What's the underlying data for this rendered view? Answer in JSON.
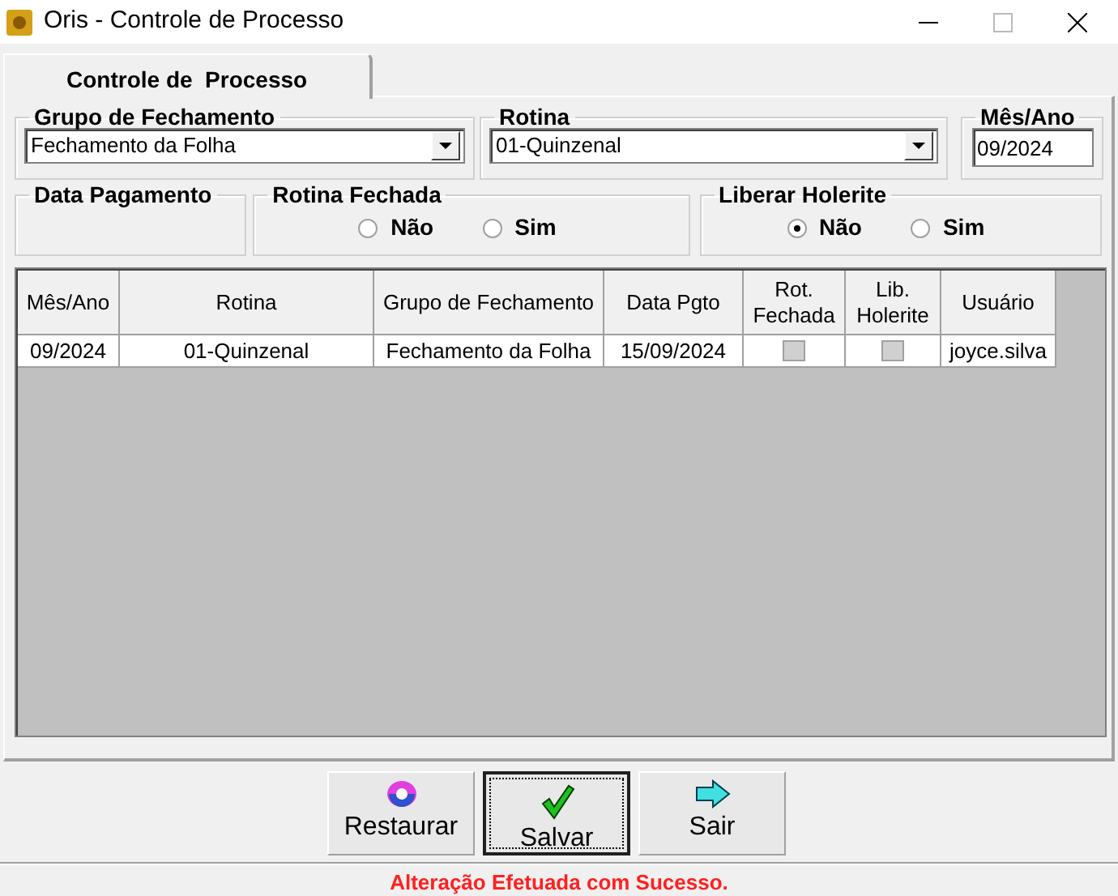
{
  "window": {
    "title": "Oris - Controle de Processo"
  },
  "tabs": [
    {
      "label": "Controle de  Processo",
      "selected": true
    }
  ],
  "grupo_fechamento": {
    "label": "Grupo de Fechamento",
    "value": "Fechamento da Folha"
  },
  "rotina": {
    "label": "Rotina",
    "value": "01-Quinzenal"
  },
  "mes_ano": {
    "label": "Mês/Ano",
    "value": "09/2024"
  },
  "data_pagamento": {
    "label": "Data Pagamento"
  },
  "rotina_fechada": {
    "label": "Rotina Fechada",
    "options": [
      {
        "label": "Não",
        "selected": false
      },
      {
        "label": "Sim",
        "selected": false
      }
    ]
  },
  "liberar_holerite": {
    "label": "Liberar Holerite",
    "options": [
      {
        "label": "Não",
        "selected": true
      },
      {
        "label": "Sim",
        "selected": false
      }
    ]
  },
  "table": {
    "columns": [
      "Mês/Ano",
      "Rotina",
      "Grupo de Fechamento",
      "Data Pgto",
      "Rot.\nFechada",
      "Lib.\nHolerite",
      "Usuário"
    ],
    "rows": [
      {
        "cells": [
          {
            "kind": "text",
            "text": "09/2024"
          },
          {
            "kind": "text",
            "text": "01-Quinzenal"
          },
          {
            "kind": "text",
            "text": "Fechamento da Folha"
          },
          {
            "kind": "text",
            "text": "15/09/2024"
          },
          {
            "kind": "checkbox",
            "checked": false
          },
          {
            "kind": "checkbox",
            "checked": false
          },
          {
            "kind": "text",
            "text": "joyce.silva"
          }
        ]
      }
    ]
  },
  "buttons": [
    {
      "label": "Restaurar",
      "kind": "restore",
      "focused": false
    },
    {
      "label": "Salvar",
      "kind": "save",
      "focused": true
    },
    {
      "label": "Sair",
      "kind": "exit",
      "focused": false
    }
  ],
  "status": {
    "message": "Alteração Efetuada com Sucesso."
  }
}
